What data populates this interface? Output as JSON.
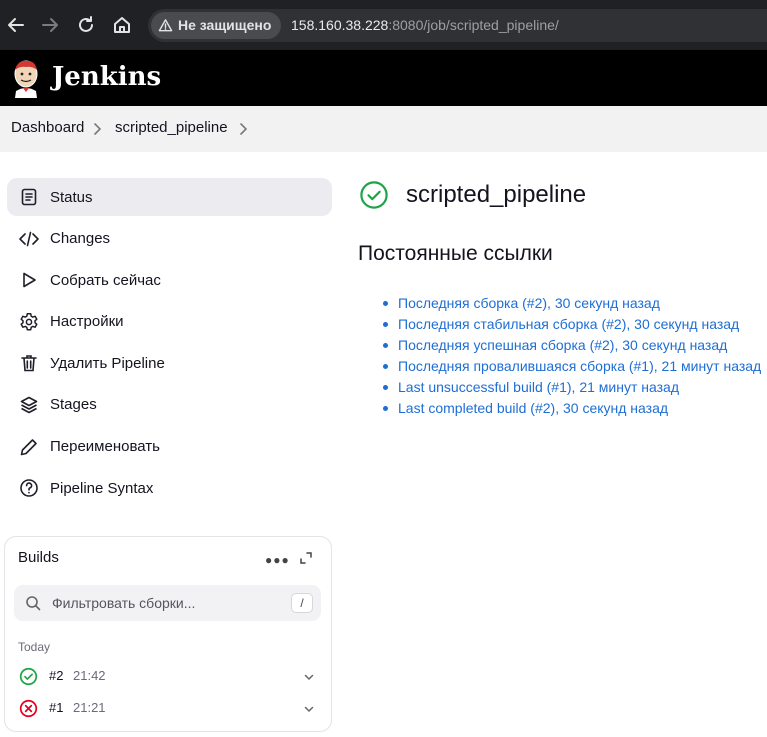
{
  "browser": {
    "security_label": "Не защищено",
    "url_host": "158.160.38.228",
    "url_rest": ":8080/job/scripted_pipeline/"
  },
  "header": {
    "brand": "Jenkins"
  },
  "breadcrumbs": {
    "items": [
      "Dashboard",
      "scripted_pipeline"
    ]
  },
  "sidebar": {
    "items": [
      {
        "label": "Status",
        "icon": "document-icon",
        "active": true
      },
      {
        "label": "Changes",
        "icon": "code-icon"
      },
      {
        "label": "Собрать сейчас",
        "icon": "play-icon"
      },
      {
        "label": "Настройки",
        "icon": "gear-icon"
      },
      {
        "label": "Удалить Pipeline",
        "icon": "trash-icon"
      },
      {
        "label": "Stages",
        "icon": "layers-icon"
      },
      {
        "label": "Переименовать",
        "icon": "pencil-icon"
      },
      {
        "label": "Pipeline Syntax",
        "icon": "help-icon"
      }
    ]
  },
  "builds": {
    "title": "Builds",
    "filter_placeholder": "Фильтровать сборки...",
    "shortcut": "/",
    "group": "Today",
    "items": [
      {
        "number": "#2",
        "time": "21:42",
        "status": "success"
      },
      {
        "number": "#1",
        "time": "21:21",
        "status": "failure"
      }
    ]
  },
  "main": {
    "title": "scripted_pipeline",
    "permalinks_heading": "Постоянные ссылки",
    "permalinks": [
      "Последняя сборка (#2), 30 секунд назад",
      "Последняя стабильная сборка (#2), 30 секунд назад",
      "Последняя успешная сборка (#2), 30 секунд назад",
      "Последняя провалившаяся сборка (#1), 21 минут назад",
      "Last unsuccessful build (#1), 21 минут назад",
      "Last completed build (#2), 30 секунд назад"
    ]
  },
  "colors": {
    "success": "#1ea446",
    "failure": "#e6001f",
    "link": "#1e6ed4"
  }
}
